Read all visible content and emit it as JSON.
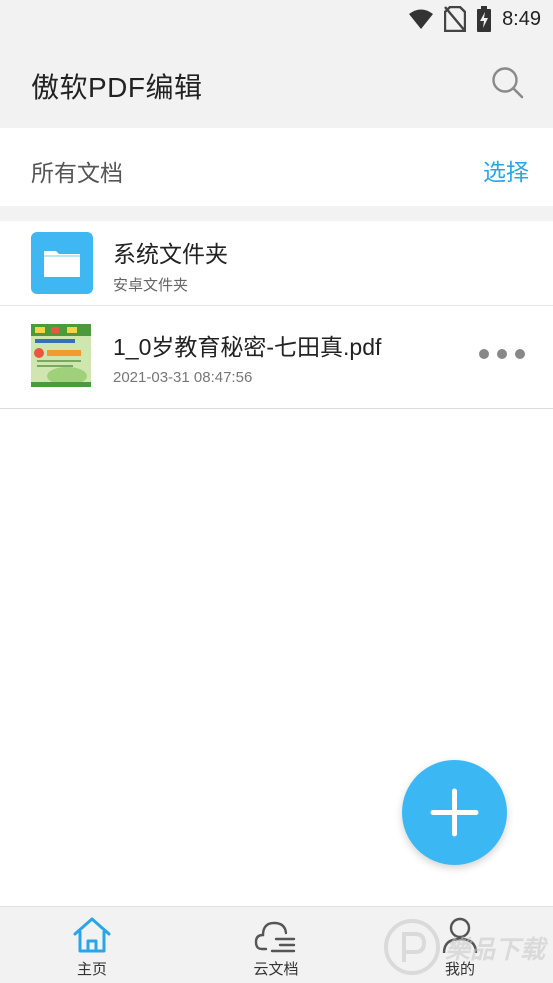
{
  "status_bar": {
    "time": "8:49",
    "icons": [
      "wifi-icon",
      "no-sim-icon",
      "battery-charging-icon"
    ]
  },
  "app_bar": {
    "title": "傲软PDF编辑",
    "search_icon": "search-icon"
  },
  "section": {
    "title": "所有文档",
    "select_label": "选择"
  },
  "files": [
    {
      "name": "系统文件夹",
      "subtitle": "安卓文件夹",
      "icon": "folder-icon"
    },
    {
      "name": "1_0岁教育秘密-七田真.pdf",
      "subtitle": "2021-03-31 08:47:56",
      "icon": "pdf-thumbnail",
      "menu_icon": "more-icon"
    }
  ],
  "fab": {
    "icon": "plus-icon"
  },
  "bottom_nav": {
    "items": [
      {
        "label": "主页",
        "icon": "home-icon",
        "active": true
      },
      {
        "label": "云文档",
        "icon": "cloud-icon",
        "active": false
      },
      {
        "label": "我的",
        "icon": "person-icon",
        "active": false
      }
    ]
  },
  "watermark": {
    "text": "樂品下载"
  },
  "colors": {
    "accent": "#2aa6e8",
    "fab": "#3bb8f4",
    "folder": "#3eb7f3",
    "background": "#f2f2f2"
  }
}
